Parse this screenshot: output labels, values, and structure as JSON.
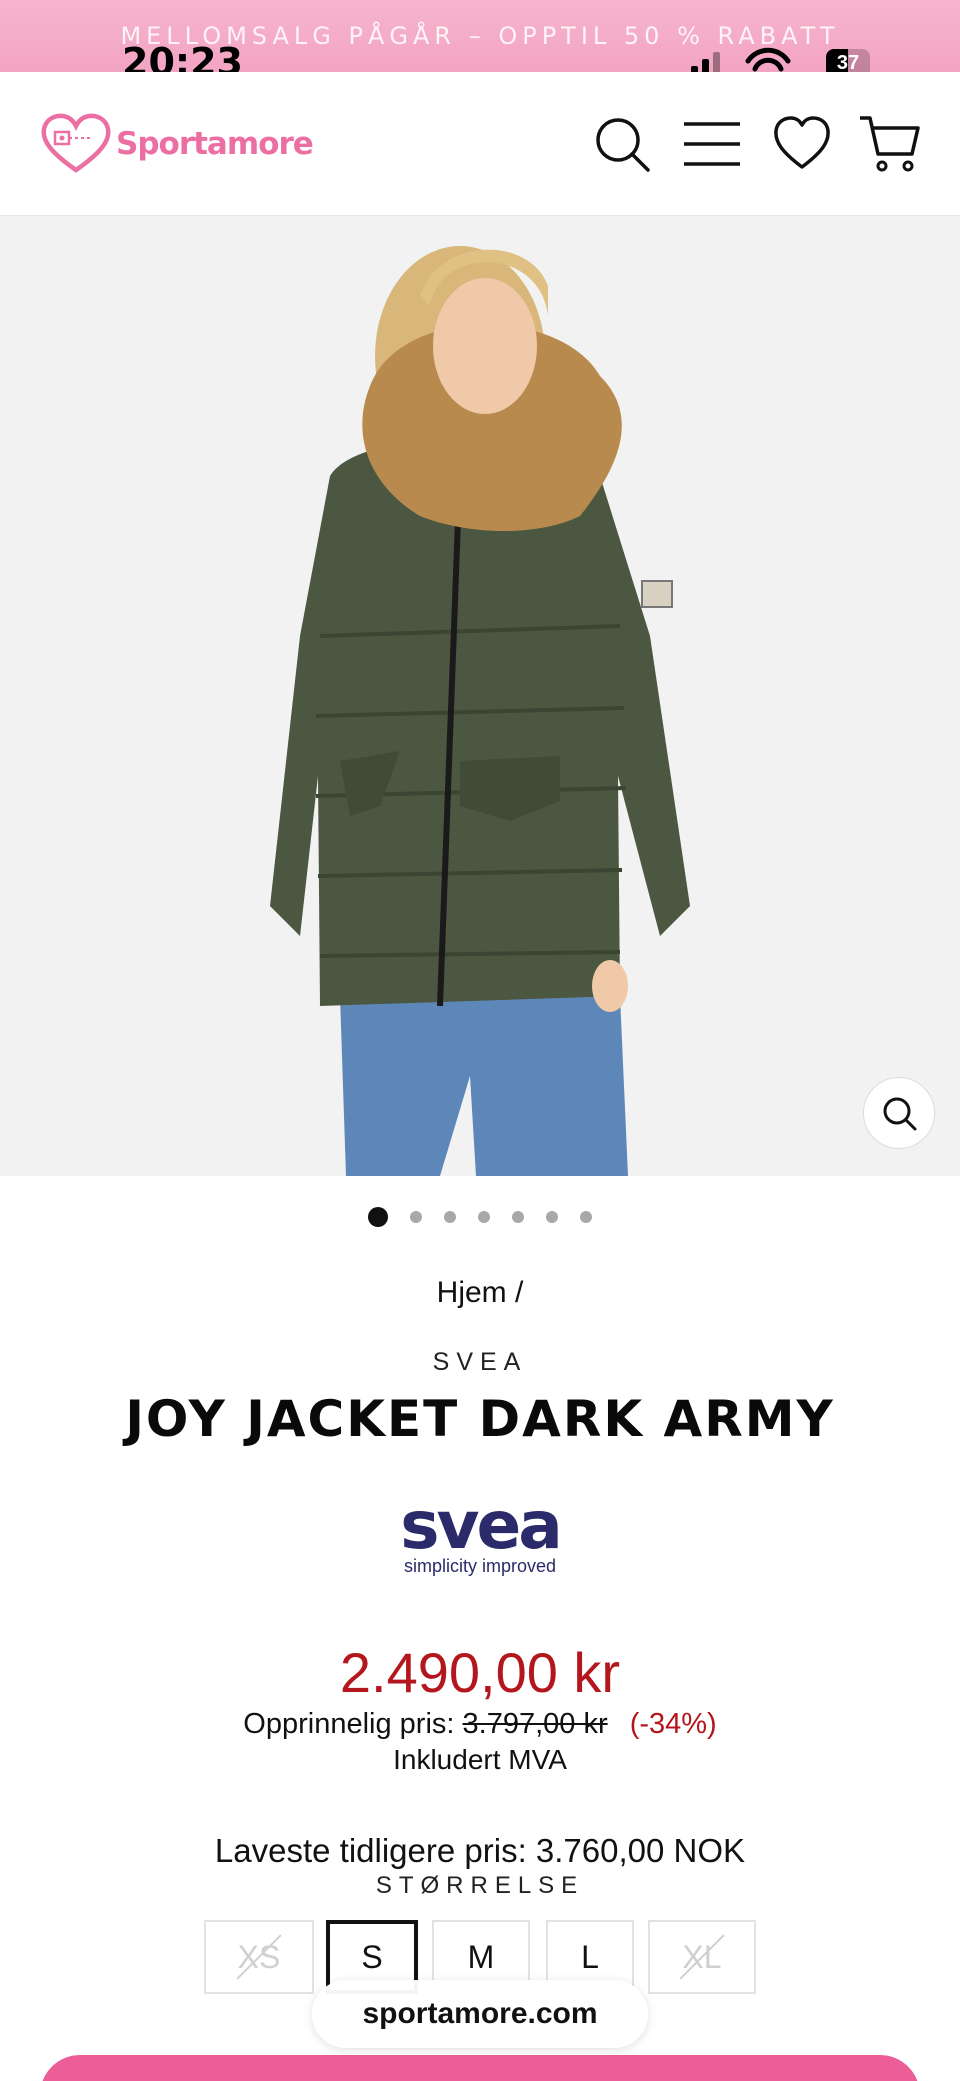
{
  "promo_banner": {
    "text": "MELLOMSALG PÅGÅR – OPPTIL 50 % RABATT"
  },
  "status_bar": {
    "time": "20:23",
    "battery": "37"
  },
  "header": {
    "logo_text": "Sportamore",
    "icons": [
      "search-icon",
      "menu-icon",
      "heart-icon",
      "cart-icon"
    ]
  },
  "gallery": {
    "image_count": 7,
    "active_index": 0
  },
  "breadcrumb": {
    "text": "Hjem /"
  },
  "product": {
    "brand": "SVEA",
    "title": "JOY JACKET DARK ARMY",
    "brand_logo": {
      "name": "svea",
      "tagline": "simplicity improved"
    },
    "price": "2.490,00 kr",
    "original_price_label": "Opprinnelig pris:",
    "original_price": "3.797,00 kr",
    "discount": "(-34%)",
    "vat_note": "Inkludert MVA",
    "lowest_previous_price": "Laveste tidligere pris: 3.760,00 NOK",
    "size_label": "STØRRELSE",
    "sizes": [
      {
        "label": "XS",
        "available": false,
        "selected": false
      },
      {
        "label": "S",
        "available": true,
        "selected": true
      },
      {
        "label": "M",
        "available": true,
        "selected": false
      },
      {
        "label": "L",
        "available": true,
        "selected": false
      },
      {
        "label": "XL",
        "available": false,
        "selected": false
      }
    ]
  },
  "browser": {
    "url": "sportamore.com"
  },
  "colors": {
    "accent_pink": "#ec5e97",
    "sale_red": "#b3171d",
    "banner_pink": "#f3a4c2",
    "brand_navy": "#2b2a6b"
  }
}
